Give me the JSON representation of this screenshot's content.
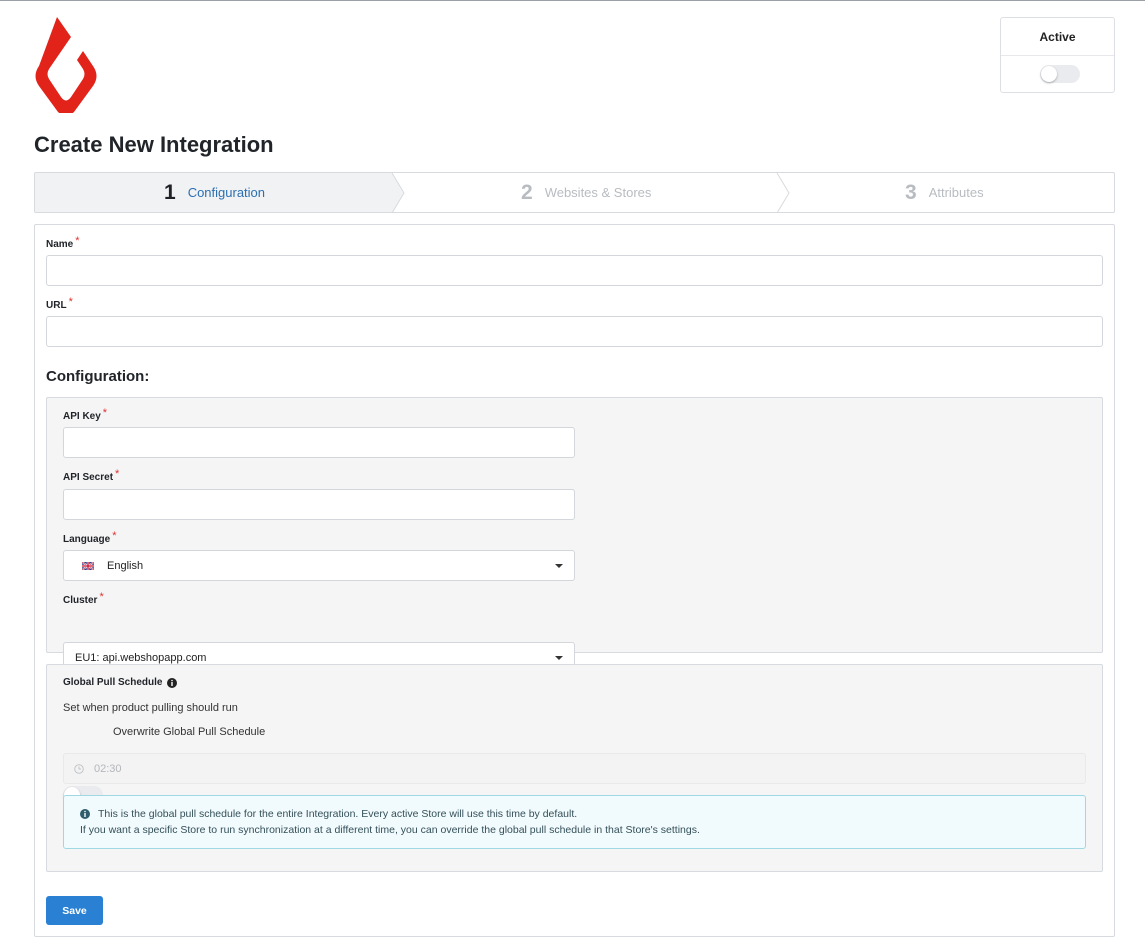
{
  "header": {
    "brand_logo": "lightspeed-flame-logo",
    "active_label": "Active",
    "active_enabled": false
  },
  "page": {
    "title": "Create New Integration"
  },
  "steps": [
    {
      "number": "1",
      "label": "Configuration",
      "state": "active"
    },
    {
      "number": "2",
      "label": "Websites & Stores",
      "state": "inactive"
    },
    {
      "number": "3",
      "label": "Attributes",
      "state": "inactive"
    }
  ],
  "form": {
    "name": {
      "label": "Name",
      "required": "*",
      "value": ""
    },
    "url": {
      "label": "URL",
      "required": "*",
      "value": ""
    },
    "configuration_title": "Configuration:",
    "api_key": {
      "label": "API Key",
      "required": "*",
      "value": ""
    },
    "api_secret": {
      "label": "API Secret",
      "required": "*",
      "value": ""
    },
    "language": {
      "label": "Language",
      "required": "*",
      "value": "English",
      "flag_icon": "uk-flag-icon"
    },
    "cluster": {
      "label": "Cluster",
      "required": "*",
      "value": "EU1: api.webshopapp.com"
    }
  },
  "schedule": {
    "title": "Global Pull Schedule",
    "subtitle": "Set when product pulling should run",
    "overwrite_label": "Overwrite Global Pull Schedule",
    "overwrite_enabled": false,
    "time_value": "02:30",
    "info_line1": "This is the global pull schedule for the entire Integration. Every active Store will use this time by default.",
    "info_line2": "If you want a specific Store to run synchronization at a different time, you can override the global pull schedule in that Store's settings."
  },
  "actions": {
    "save_label": "Save"
  },
  "colors": {
    "brand_red": "#e2231a",
    "primary_blue": "#2a81d4",
    "step_active_blue": "#2b6fb0",
    "required_red": "#e03131"
  }
}
